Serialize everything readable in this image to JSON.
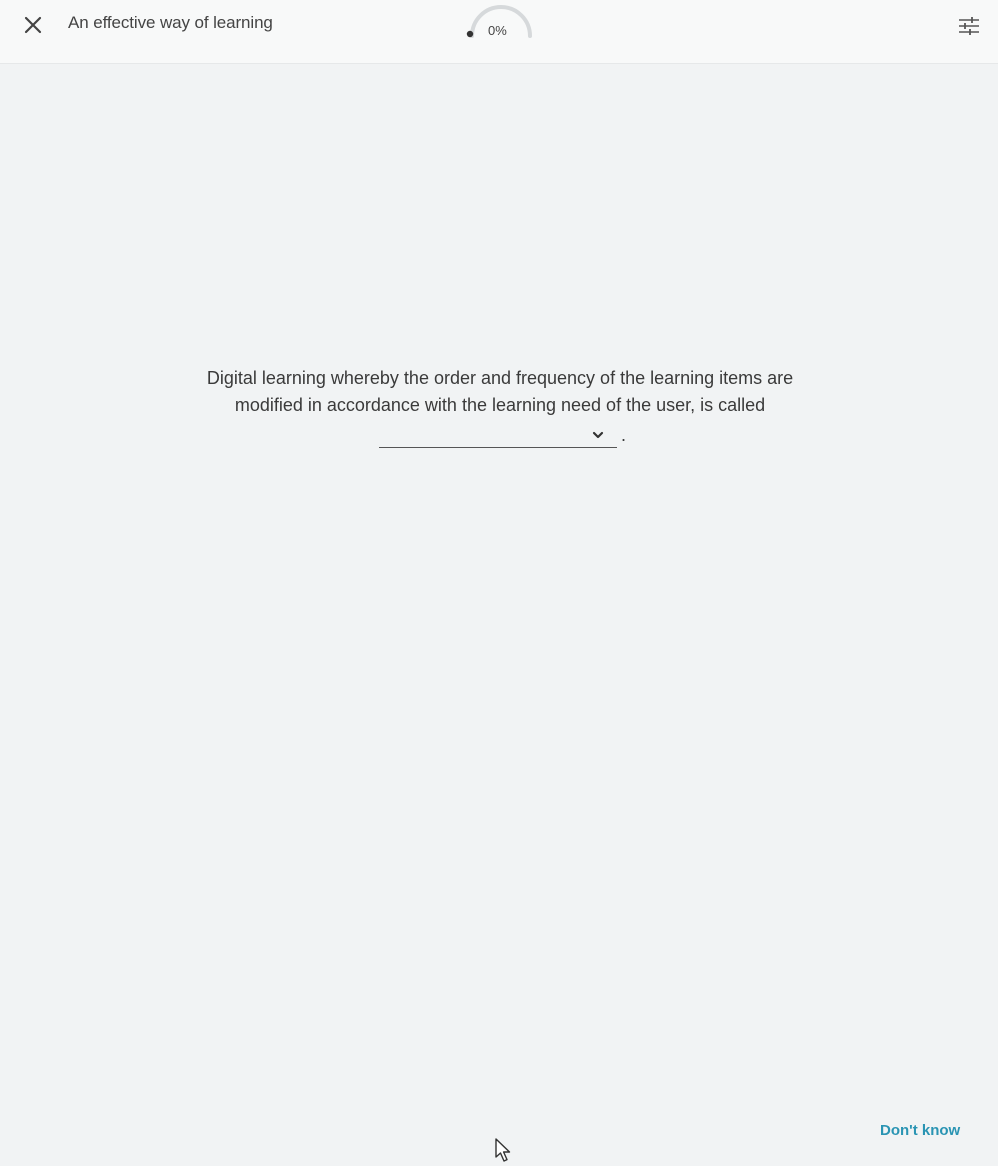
{
  "header": {
    "title": "An effective way of learning",
    "progress": "0%",
    "progress_value": 0,
    "close_icon": "close-icon",
    "settings_icon": "sliders-icon"
  },
  "question": {
    "line1": "Digital learning whereby the order and frequency of the learning items are",
    "line2": "modified in accordance with the learning need of the user, is called",
    "answer_value": "",
    "period": "."
  },
  "footer": {
    "dont_know_label": "Don't know"
  },
  "colors": {
    "background": "#f1f3f4",
    "accent": "#2a94b3",
    "progress_track": "#d6d9db",
    "progress_dot": "#333333"
  }
}
